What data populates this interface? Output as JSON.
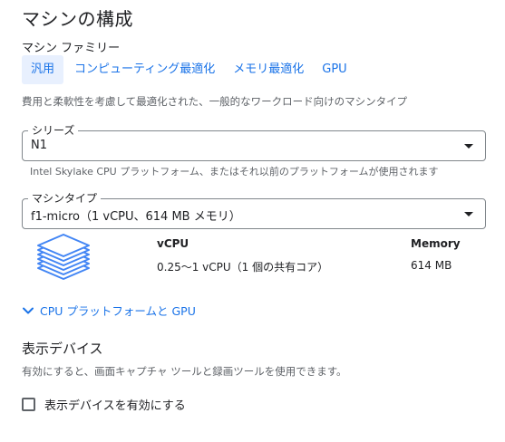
{
  "section": {
    "title": "マシンの構成",
    "family_label": "マシン ファミリー",
    "family_description": "費用と柔軟性を考慮して最適化された、一般的なワークロード向けのマシンタイプ"
  },
  "tabs": [
    {
      "label": "汎用",
      "active": true
    },
    {
      "label": "コンピューティング最適化",
      "active": false
    },
    {
      "label": "メモリ最適化",
      "active": false
    },
    {
      "label": "GPU",
      "active": false
    }
  ],
  "series": {
    "legend": "シリーズ",
    "value": "N1",
    "hint": "Intel Skylake CPU プラットフォーム、またはそれ以前のプラットフォームが使用されます"
  },
  "machine_type": {
    "legend": "マシンタイプ",
    "value": "f1-micro（1 vCPU、614 MB メモリ）"
  },
  "specs": {
    "vcpu_header": "vCPU",
    "vcpu_value": "0.25〜1 vCPU（1 個の共有コア）",
    "memory_header": "Memory",
    "memory_value": "614 MB"
  },
  "expander": {
    "label": "CPU プラットフォームと GPU"
  },
  "display_device": {
    "title": "表示デバイス",
    "description": "有効にすると、画面キャプチャ ツールと録画ツールを使用できます。",
    "checkbox_label": "表示デバイスを有効にする",
    "checked": false
  },
  "colors": {
    "accent": "#1a73e8",
    "active_tab_bg": "#e8f0fe",
    "chip_icon": "#4285f4"
  },
  "icons": {
    "machine": "stacked-chip-icon",
    "expander": "chevron-down-icon",
    "dropdown": "dropdown-arrow-icon"
  }
}
